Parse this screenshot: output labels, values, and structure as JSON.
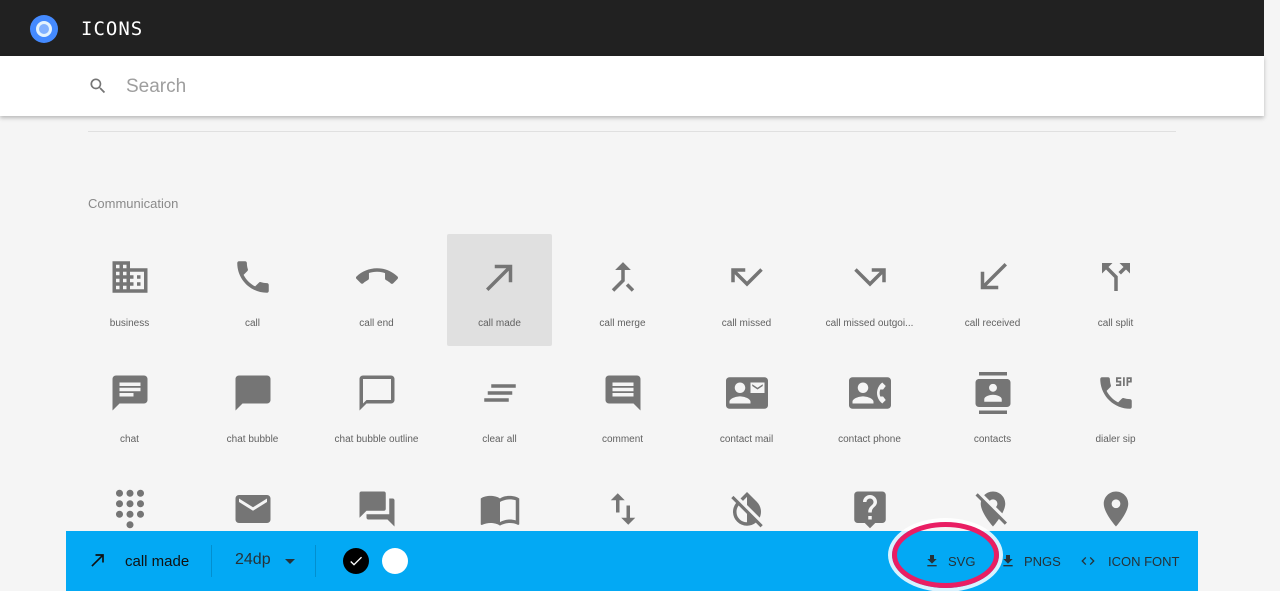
{
  "app": {
    "title": "ICONS"
  },
  "search": {
    "placeholder": "Search"
  },
  "section": {
    "title": "Communication"
  },
  "icons": [
    {
      "label": "business",
      "icon": "business-icon"
    },
    {
      "label": "call",
      "icon": "call-icon"
    },
    {
      "label": "call end",
      "icon": "call-end-icon"
    },
    {
      "label": "call made",
      "icon": "call-made-icon",
      "selected": true
    },
    {
      "label": "call merge",
      "icon": "call-merge-icon"
    },
    {
      "label": "call missed",
      "icon": "call-missed-icon"
    },
    {
      "label": "call missed outgoi...",
      "icon": "call-missed-outgoing-icon"
    },
    {
      "label": "call received",
      "icon": "call-received-icon"
    },
    {
      "label": "call split",
      "icon": "call-split-icon"
    },
    {
      "label": "chat",
      "icon": "chat-icon"
    },
    {
      "label": "chat bubble",
      "icon": "chat-bubble-icon"
    },
    {
      "label": "chat bubble outline",
      "icon": "chat-bubble-outline-icon"
    },
    {
      "label": "clear all",
      "icon": "clear-all-icon"
    },
    {
      "label": "comment",
      "icon": "comment-icon"
    },
    {
      "label": "contact mail",
      "icon": "contact-mail-icon"
    },
    {
      "label": "contact phone",
      "icon": "contact-phone-icon"
    },
    {
      "label": "contacts",
      "icon": "contacts-icon"
    },
    {
      "label": "dialer sip",
      "icon": "dialer-sip-icon"
    },
    {
      "label": "",
      "icon": "dialpad-icon"
    },
    {
      "label": "",
      "icon": "email-icon"
    },
    {
      "label": "",
      "icon": "forum-icon"
    },
    {
      "label": "",
      "icon": "import-contacts-icon"
    },
    {
      "label": "",
      "icon": "import-export-icon"
    },
    {
      "label": "",
      "icon": "invert-colors-off-icon"
    },
    {
      "label": "",
      "icon": "live-help-icon"
    },
    {
      "label": "",
      "icon": "location-off-icon"
    },
    {
      "label": "",
      "icon": "location-on-icon"
    }
  ],
  "bottom_bar": {
    "selected_name": "call made",
    "selected_icon": "call-made-icon",
    "size": "24dp",
    "download_svg": "SVG",
    "download_pngs": "PNGS",
    "icon_font": "ICON FONT",
    "background": "#03a9f4",
    "swatches": [
      "#000000",
      "#ffffff"
    ]
  },
  "colors": {
    "icon": "#757575",
    "highlight": "#e91e63",
    "topbar": "#212121"
  }
}
